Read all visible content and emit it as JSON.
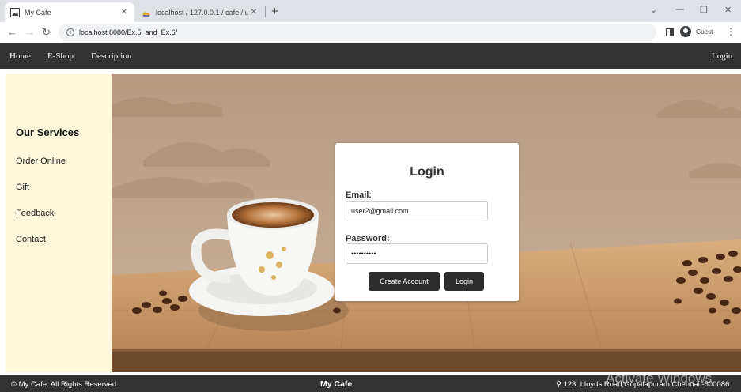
{
  "browser": {
    "tabs": [
      {
        "title": "My Cafe",
        "icon": "image-icon"
      },
      {
        "title": "localhost / 127.0.0.1 / cafe / use",
        "icon": "phpmyadmin-icon"
      }
    ],
    "address": "localhost:8080/Ex.5_and_Ex.6/",
    "profile_label": "Guest"
  },
  "nav": {
    "links": [
      "Home",
      "E-Shop",
      "Description"
    ],
    "login": "Login"
  },
  "sidebar": {
    "title": "Our Services",
    "items": [
      "Order Online",
      "Gift",
      "Feedback",
      "Contact"
    ]
  },
  "login": {
    "title": "Login",
    "email_label": "Email:",
    "email_value": "user2@gmail.com",
    "password_label": "Password:",
    "password_value": "••••••••••",
    "create_button": "Create Account",
    "login_button": "Login"
  },
  "footer": {
    "copyright": "© My Cafe. All Rights Reserved",
    "brand": "My Cafe",
    "address": "123, Lloyds Road,Gopalapuram,Chennai -600086"
  },
  "watermark": "Activate Windows",
  "colors": {
    "nav_bg": "#333333",
    "sidebar_bg": "#fff7dc",
    "button_bg": "#2b2b2b"
  }
}
